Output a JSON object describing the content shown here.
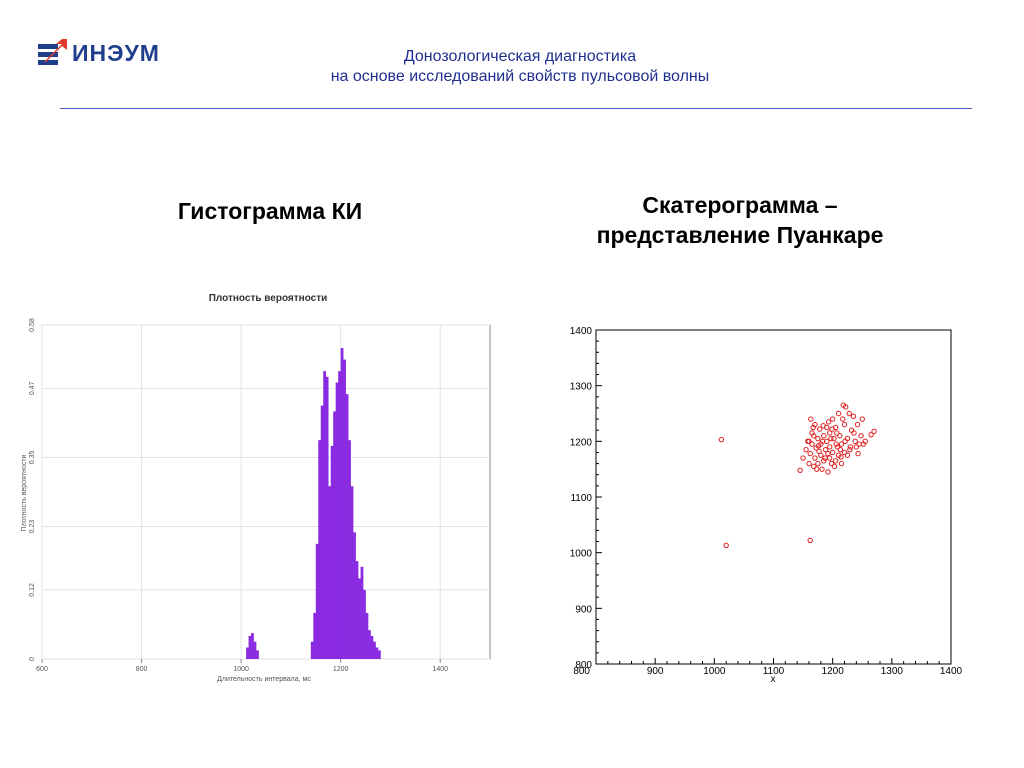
{
  "header": {
    "logo_text": "ИНЭУМ",
    "title_line1": "Донозологическая диагностика",
    "title_line2": "на основе исследований свойств пульсовой волны"
  },
  "colors": {
    "accent": "#1f2f8f",
    "logo_red": "#e03a2f",
    "logo_blue": "#1f3e8c",
    "bar": "#8a2be2",
    "points": "#e02020"
  },
  "sections": {
    "left_heading": "Гистограмма КИ",
    "right_heading_line1": "Скатерограмма –",
    "right_heading_line2": "представление Пуанкаре"
  },
  "chart_data": [
    {
      "type": "bar",
      "title": "Плотность вероятности",
      "xlabel": "Длительность интервала, мс",
      "ylabel": "Плотность вероятности",
      "xlim": [
        600,
        1500
      ],
      "ylim": [
        0,
        0.58
      ],
      "xticks": [
        "600",
        "800",
        "1000",
        "1200",
        "1400"
      ],
      "yticks": [
        "0",
        "0.12",
        "0.23",
        "0.35",
        "0.47",
        "0.58"
      ],
      "grid": true,
      "bins": [
        [
          1010,
          0.02
        ],
        [
          1015,
          0.04
        ],
        [
          1020,
          0.045
        ],
        [
          1025,
          0.03
        ],
        [
          1030,
          0.015
        ],
        [
          1140,
          0.03
        ],
        [
          1145,
          0.08
        ],
        [
          1150,
          0.2
        ],
        [
          1155,
          0.38
        ],
        [
          1160,
          0.44
        ],
        [
          1165,
          0.5
        ],
        [
          1170,
          0.49
        ],
        [
          1175,
          0.3
        ],
        [
          1180,
          0.37
        ],
        [
          1185,
          0.43
        ],
        [
          1190,
          0.48
        ],
        [
          1195,
          0.5
        ],
        [
          1200,
          0.54
        ],
        [
          1205,
          0.52
        ],
        [
          1210,
          0.46
        ],
        [
          1215,
          0.38
        ],
        [
          1220,
          0.3
        ],
        [
          1225,
          0.22
        ],
        [
          1230,
          0.17
        ],
        [
          1235,
          0.14
        ],
        [
          1240,
          0.16
        ],
        [
          1245,
          0.12
        ],
        [
          1250,
          0.08
        ],
        [
          1255,
          0.05
        ],
        [
          1260,
          0.04
        ],
        [
          1265,
          0.03
        ],
        [
          1270,
          0.02
        ],
        [
          1275,
          0.015
        ]
      ]
    },
    {
      "type": "scatter",
      "xlabel": "x",
      "xlim": [
        800,
        1400
      ],
      "ylim": [
        800,
        1400
      ],
      "xticks": [
        "800",
        "900",
        "1000",
        "1100",
        "1200",
        "1300",
        "1400"
      ],
      "yticks": [
        "800",
        "900",
        "1000",
        "1100",
        "1200",
        "1300",
        "1400"
      ],
      "points": [
        [
          1012,
          1203
        ],
        [
          1020,
          1013
        ],
        [
          1162,
          1022
        ],
        [
          1145,
          1148
        ],
        [
          1150,
          1170
        ],
        [
          1155,
          1185
        ],
        [
          1158,
          1200
        ],
        [
          1160,
          1160
        ],
        [
          1162,
          1178
        ],
        [
          1165,
          1195
        ],
        [
          1165,
          1215
        ],
        [
          1168,
          1155
        ],
        [
          1170,
          1170
        ],
        [
          1170,
          1230
        ],
        [
          1172,
          1188
        ],
        [
          1175,
          1205
        ],
        [
          1175,
          1160
        ],
        [
          1178,
          1222
        ],
        [
          1180,
          1175
        ],
        [
          1180,
          1195
        ],
        [
          1182,
          1150
        ],
        [
          1185,
          1210
        ],
        [
          1185,
          1165
        ],
        [
          1188,
          1185
        ],
        [
          1190,
          1225
        ],
        [
          1190,
          1200
        ],
        [
          1192,
          1145
        ],
        [
          1195,
          1170
        ],
        [
          1195,
          1190
        ],
        [
          1195,
          1215
        ],
        [
          1198,
          1160
        ],
        [
          1200,
          1240
        ],
        [
          1200,
          1180
        ],
        [
          1202,
          1205
        ],
        [
          1205,
          1165
        ],
        [
          1205,
          1225
        ],
        [
          1208,
          1190
        ],
        [
          1210,
          1175
        ],
        [
          1210,
          1250
        ],
        [
          1212,
          1210
        ],
        [
          1215,
          1160
        ],
        [
          1215,
          1195
        ],
        [
          1218,
          1265
        ],
        [
          1220,
          1180
        ],
        [
          1220,
          1230
        ],
        [
          1222,
          1262
        ],
        [
          1225,
          1175
        ],
        [
          1225,
          1205
        ],
        [
          1228,
          1250
        ],
        [
          1230,
          1190
        ],
        [
          1232,
          1220
        ],
        [
          1235,
          1245
        ],
        [
          1238,
          1200
        ],
        [
          1240,
          1190
        ],
        [
          1242,
          1230
        ],
        [
          1245,
          1195
        ],
        [
          1248,
          1210
        ],
        [
          1250,
          1240
        ],
        [
          1252,
          1195
        ],
        [
          1255,
          1200
        ],
        [
          1265,
          1212
        ],
        [
          1270,
          1218
        ],
        [
          1163,
          1240
        ],
        [
          1167,
          1225
        ],
        [
          1173,
          1150
        ],
        [
          1177,
          1182
        ],
        [
          1183,
          1200
        ],
        [
          1187,
          1170
        ],
        [
          1193,
          1235
        ],
        [
          1197,
          1205
        ],
        [
          1203,
          1155
        ],
        [
          1207,
          1215
        ],
        [
          1213,
          1185
        ],
        [
          1217,
          1240
        ],
        [
          1160,
          1200
        ],
        [
          1168,
          1210
        ],
        [
          1176,
          1192
        ],
        [
          1184,
          1228
        ],
        [
          1192,
          1178
        ],
        [
          1199,
          1222
        ],
        [
          1206,
          1195
        ],
        [
          1214,
          1172
        ],
        [
          1221,
          1200
        ],
        [
          1229,
          1185
        ],
        [
          1236,
          1215
        ],
        [
          1243,
          1178
        ]
      ]
    }
  ]
}
